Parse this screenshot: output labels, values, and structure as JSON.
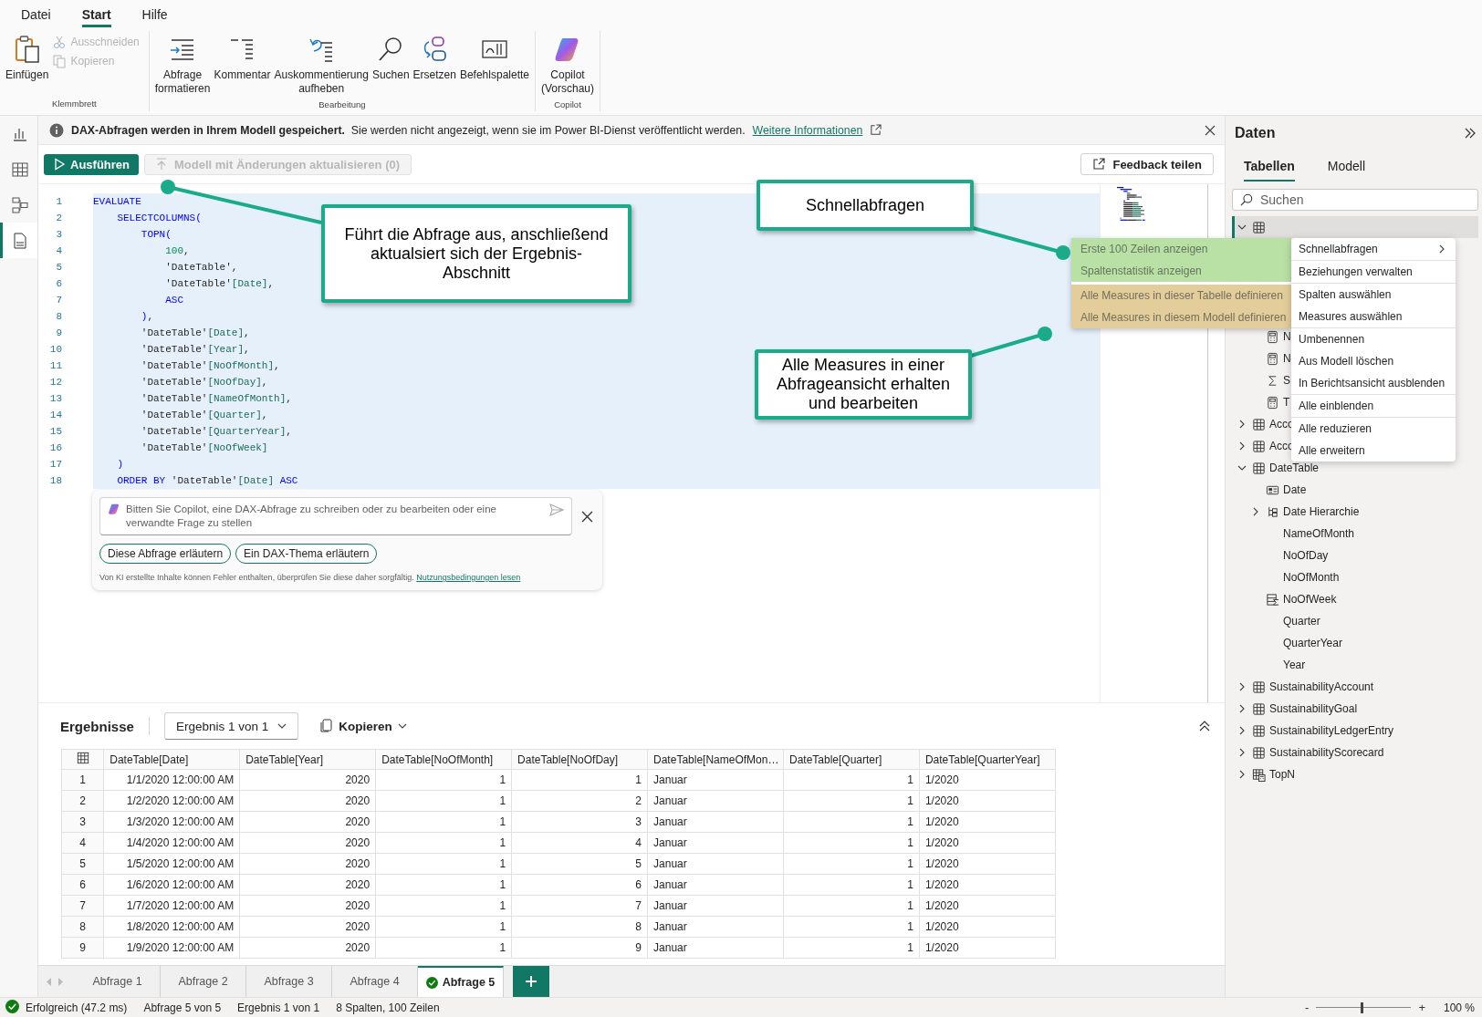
{
  "menu_tabs": [
    {
      "label": "Datei",
      "selected": false
    },
    {
      "label": "Start",
      "selected": true
    },
    {
      "label": "Hilfe",
      "selected": false
    }
  ],
  "ribbon": {
    "groups": [
      {
        "label": "Klemmbrett",
        "buttons": [
          {
            "kind": "large",
            "label": "Einfügen",
            "disabled": false
          },
          {
            "kind": "small",
            "label": "Ausschneiden",
            "disabled": true
          },
          {
            "kind": "small",
            "label": "Kopieren",
            "disabled": true
          }
        ]
      },
      {
        "label": "Bearbeitung",
        "buttons": [
          {
            "kind": "large",
            "label": "Abfrage formatieren",
            "disabled": false
          },
          {
            "kind": "large",
            "label": "Kommentar",
            "disabled": false
          },
          {
            "kind": "large",
            "label": "Auskommentierung aufheben",
            "disabled": false
          },
          {
            "kind": "large",
            "label": "Suchen",
            "disabled": false
          },
          {
            "kind": "large",
            "label": "Ersetzen",
            "disabled": false
          },
          {
            "kind": "large",
            "label": "Befehlspalette",
            "disabled": false
          }
        ]
      },
      {
        "label": "Copilot",
        "buttons": [
          {
            "kind": "large",
            "label": "Copilot (Vorschau)",
            "disabled": false
          }
        ]
      }
    ]
  },
  "views": [
    {
      "selected": false
    },
    {
      "selected": false
    },
    {
      "selected": false
    },
    {
      "selected": true
    }
  ],
  "info_bar": {
    "message": "**DAX-Abfragen werden in Ihrem Modell gespeichert.**  Sie werden nicht angezeigt, wenn sie im Power BI-Dienst veröffentlicht werden.",
    "link": "Weitere Informationen"
  },
  "toolbar": {
    "run": "Ausführen",
    "update": {
      "label": "Modell mit Änderungen aktualisieren (0)",
      "disabled": true
    },
    "feedback": "Feedback teilen"
  },
  "code": {
    "selected": true,
    "lines": [
      {
        "number": "1",
        "tokens": [
          {
            "kind": "keyword",
            "text": "EVALUATE"
          }
        ]
      },
      {
        "number": "2",
        "tokens": [
          {
            "kind": "keyword",
            "text": "    SELECTCOLUMNS("
          }
        ]
      },
      {
        "number": "3",
        "tokens": [
          {
            "kind": "keyword",
            "text": "        TOPN("
          }
        ]
      },
      {
        "number": "4",
        "tokens": [
          {
            "kind": "number",
            "text": "            100"
          },
          {
            "kind": "plain",
            "text": ","
          }
        ]
      },
      {
        "number": "5",
        "tokens": [
          {
            "kind": "string",
            "text": "            'DateTable'"
          },
          {
            "kind": "plain",
            "text": ","
          }
        ]
      },
      {
        "number": "6",
        "tokens": [
          {
            "kind": "string",
            "text": "            'DateTable'"
          },
          {
            "kind": "column",
            "text": "[Date]"
          },
          {
            "kind": "plain",
            "text": ","
          }
        ]
      },
      {
        "number": "7",
        "tokens": [
          {
            "kind": "keyword",
            "text": "            ASC"
          }
        ]
      },
      {
        "number": "8",
        "tokens": [
          {
            "kind": "keyword",
            "text": "        )"
          },
          {
            "kind": "plain",
            "text": ","
          }
        ]
      },
      {
        "number": "9",
        "tokens": [
          {
            "kind": "string",
            "text": "        'DateTable'"
          },
          {
            "kind": "column",
            "text": "[Date]"
          },
          {
            "kind": "plain",
            "text": ","
          }
        ]
      },
      {
        "number": "10",
        "tokens": [
          {
            "kind": "string",
            "text": "        'DateTable'"
          },
          {
            "kind": "column",
            "text": "[Year]"
          },
          {
            "kind": "plain",
            "text": ","
          }
        ]
      },
      {
        "number": "11",
        "tokens": [
          {
            "kind": "string",
            "text": "        'DateTable'"
          },
          {
            "kind": "column",
            "text": "[NoOfMonth]"
          },
          {
            "kind": "plain",
            "text": ","
          }
        ]
      },
      {
        "number": "12",
        "tokens": [
          {
            "kind": "string",
            "text": "        'DateTable'"
          },
          {
            "kind": "column",
            "text": "[NoOfDay]"
          },
          {
            "kind": "plain",
            "text": ","
          }
        ]
      },
      {
        "number": "13",
        "tokens": [
          {
            "kind": "string",
            "text": "        'DateTable'"
          },
          {
            "kind": "column",
            "text": "[NameOfMonth]"
          },
          {
            "kind": "plain",
            "text": ","
          }
        ]
      },
      {
        "number": "14",
        "tokens": [
          {
            "kind": "string",
            "text": "        'DateTable'"
          },
          {
            "kind": "column",
            "text": "[Quarter]"
          },
          {
            "kind": "plain",
            "text": ","
          }
        ]
      },
      {
        "number": "15",
        "tokens": [
          {
            "kind": "string",
            "text": "        'DateTable'"
          },
          {
            "kind": "column",
            "text": "[QuarterYear]"
          },
          {
            "kind": "plain",
            "text": ","
          }
        ]
      },
      {
        "number": "16",
        "tokens": [
          {
            "kind": "string",
            "text": "        'DateTable'"
          },
          {
            "kind": "column",
            "text": "[NoOfWeek]"
          }
        ]
      },
      {
        "number": "17",
        "tokens": [
          {
            "kind": "keyword",
            "text": "    )"
          }
        ]
      },
      {
        "number": "18",
        "tokens": [
          {
            "kind": "keyword",
            "text": "    ORDER BY "
          },
          {
            "kind": "string",
            "text": "'DateTable'"
          },
          {
            "kind": "column",
            "text": "[Date]"
          },
          {
            "kind": "keyword",
            "text": " ASC"
          }
        ]
      }
    ]
  },
  "copilot": {
    "placeholder": "Bitten Sie Copilot, eine DAX-Abfrage zu schreiben oder zu bearbeiten oder eine verwandte Frage zu stellen",
    "chips": [
      "Diese Abfrage erläutern",
      "Ein DAX-Thema erläutern"
    ],
    "disclaimer": "Von KI erstellte Inhalte können Fehler enthalten, überprüfen Sie diese daher sorgfältig.",
    "link": "Nutzungsbedingungen lesen"
  },
  "results": {
    "title": "Ergebnisse",
    "result_select": "Ergebnis 1 von 1",
    "copy": "Kopieren",
    "table": {
      "columns": [
        {
          "label": "DateTable[Date]",
          "kind": "date"
        },
        {
          "label": "DateTable[Year]",
          "kind": "number"
        },
        {
          "label": "DateTable[NoOfMonth]",
          "kind": "number"
        },
        {
          "label": "DateTable[NoOfDay]",
          "kind": "number"
        },
        {
          "label": "DateTable[NameOfMon…",
          "kind": "text"
        },
        {
          "label": "DateTable[Quarter]",
          "kind": "number"
        },
        {
          "label": "DateTable[QuarterYear]",
          "kind": "text"
        }
      ],
      "rows": [
        {
          "index": "1",
          "cells": [
            "1/1/2020 12:00:00 AM",
            "2020",
            "1",
            "1",
            "Januar",
            "1",
            "1/2020"
          ]
        },
        {
          "index": "2",
          "cells": [
            "1/2/2020 12:00:00 AM",
            "2020",
            "1",
            "2",
            "Januar",
            "1",
            "1/2020"
          ]
        },
        {
          "index": "3",
          "cells": [
            "1/3/2020 12:00:00 AM",
            "2020",
            "1",
            "3",
            "Januar",
            "1",
            "1/2020"
          ]
        },
        {
          "index": "4",
          "cells": [
            "1/4/2020 12:00:00 AM",
            "2020",
            "1",
            "4",
            "Januar",
            "1",
            "1/2020"
          ]
        },
        {
          "index": "5",
          "cells": [
            "1/5/2020 12:00:00 AM",
            "2020",
            "1",
            "5",
            "Januar",
            "1",
            "1/2020"
          ]
        },
        {
          "index": "6",
          "cells": [
            "1/6/2020 12:00:00 AM",
            "2020",
            "1",
            "6",
            "Januar",
            "1",
            "1/2020"
          ]
        },
        {
          "index": "7",
          "cells": [
            "1/7/2020 12:00:00 AM",
            "2020",
            "1",
            "7",
            "Januar",
            "1",
            "1/2020"
          ]
        },
        {
          "index": "8",
          "cells": [
            "1/8/2020 12:00:00 AM",
            "2020",
            "1",
            "8",
            "Januar",
            "1",
            "1/2020"
          ]
        },
        {
          "index": "9",
          "cells": [
            "1/9/2020 12:00:00 AM",
            "2020",
            "1",
            "9",
            "Januar",
            "1",
            "1/2020"
          ]
        }
      ]
    }
  },
  "query_tabs": [
    {
      "label": "Abfrage 1",
      "selected": false,
      "succeeded": false
    },
    {
      "label": "Abfrage 2",
      "selected": false,
      "succeeded": false
    },
    {
      "label": "Abfrage 3",
      "selected": false,
      "succeeded": false
    },
    {
      "label": "Abfrage 4",
      "selected": false,
      "succeeded": false
    },
    {
      "label": "Abfrage 5",
      "selected": true,
      "succeeded": true
    }
  ],
  "status": {
    "success": true,
    "items": [
      "Erfolgreich (47.2 ms)",
      "Abfrage 5 von 5",
      "Ergebnis 1 von 1",
      "8 Spalten, 100 Zeilen"
    ],
    "zoom_out": "-",
    "zoom_in": "+",
    "zoom": {
      "level": 0.48
    },
    "zoom_reading": "100 %"
  },
  "data_panel": {
    "title": "Daten",
    "tabs": [
      {
        "label": "Tabellen",
        "selected": true
      },
      {
        "label": "Modell",
        "selected": false
      }
    ],
    "search": {
      "placeholder": "Suchen"
    },
    "tree": [
      {
        "kind": "table",
        "selected": true,
        "expanded": true,
        "children": [
          {
            "name": "N",
            "kind": "measure",
            "selected": false
          },
          {
            "name": "N",
            "kind": "measure",
            "selected": false
          },
          {
            "name": "S",
            "kind": "sum",
            "selected": false
          },
          {
            "name": "T",
            "kind": "measure",
            "selected": false
          }
        ]
      },
      {
        "name": "Acco",
        "kind": "table",
        "selected": false,
        "expanded": false
      },
      {
        "name": "Acco",
        "kind": "table",
        "selected": false,
        "expanded": false
      },
      {
        "name": "DateTable",
        "kind": "table",
        "selected": false,
        "expanded": true,
        "children": [
          {
            "name": "Date",
            "kind": "key",
            "selected": false
          },
          {
            "name": "Date Hierarchie",
            "kind": "hierarchy",
            "selected": false,
            "expanded": false
          },
          {
            "name": "NameOfMonth",
            "kind": "column",
            "selected": false
          },
          {
            "name": "NoOfDay",
            "kind": "column",
            "selected": false
          },
          {
            "name": "NoOfMonth",
            "kind": "column",
            "selected": false
          },
          {
            "name": "NoOfWeek",
            "kind": "calculated",
            "selected": false
          },
          {
            "name": "Quarter",
            "kind": "column",
            "selected": false
          },
          {
            "name": "QuarterYear",
            "kind": "column",
            "selected": false
          },
          {
            "name": "Year",
            "kind": "column",
            "selected": false
          }
        ]
      },
      {
        "name": "SustainabilityAccount",
        "kind": "table",
        "selected": false,
        "expanded": false
      },
      {
        "name": "SustainabilityGoal",
        "kind": "table",
        "selected": false,
        "expanded": false
      },
      {
        "name": "SustainabilityLedgerEntry",
        "kind": "table",
        "selected": false,
        "expanded": false
      },
      {
        "name": "SustainabilityScorecard",
        "kind": "table",
        "selected": false,
        "expanded": false
      },
      {
        "name": "TopN",
        "kind": "calculated-table",
        "selected": false,
        "expanded": false
      }
    ]
  },
  "context_menu": {
    "items": [
      {
        "label": "Schnellabfragen",
        "kind": "submenu",
        "separator_after": true,
        "submenu": [
          {
            "label": "Erste 100 Zeilen anzeigen",
            "color": "#b9e0a5"
          },
          {
            "label": "Spaltenstatistik anzeigen",
            "color": "#b9e0a5"
          },
          {
            "label": "Alle Measures in dieser Tabelle definieren",
            "color": "#e3cd9a"
          },
          {
            "label": "Alle Measures in diesem Modell definieren",
            "color": "#e3cd9a"
          }
        ]
      },
      {
        "label": "Beziehungen verwalten",
        "kind": "item",
        "separator_after": true
      },
      {
        "label": "Spalten auswählen",
        "kind": "item",
        "separator_after": false
      },
      {
        "label": "Measures auswählen",
        "kind": "item",
        "separator_after": true
      },
      {
        "label": "Umbenennen",
        "kind": "item",
        "separator_after": false
      },
      {
        "label": "Aus Modell löschen",
        "kind": "item",
        "separator_after": false
      },
      {
        "label": "In Berichtsansicht ausblenden",
        "kind": "item",
        "separator_after": true
      },
      {
        "label": "Alle einblenden",
        "kind": "item",
        "separator_after": true
      },
      {
        "label": "Alle reduzieren",
        "kind": "item",
        "separator_after": false
      },
      {
        "label": "Alle erweitern",
        "kind": "item",
        "separator_after": false
      }
    ]
  },
  "callouts": [
    {
      "text": "Führt die Abfrage aus, anschließend aktualsiert sich der Ergebnis-Abschnitt"
    },
    {
      "text": "Schnellabfragen"
    },
    {
      "text": "Alle Measures in einer Abfrageansicht erhalten und bearbeiten"
    }
  ]
}
